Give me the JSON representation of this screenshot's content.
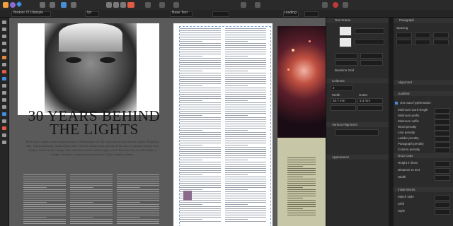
{
  "toolbar": {
    "personas": [
      "publisher-persona-icon",
      "photo-persona-icon",
      "designer-persona-icon"
    ],
    "font_size": "7pt"
  },
  "context": {
    "font_name": "Bodoni 72 Oldstyle",
    "font_size": "7pt",
    "leading_label": "Leading",
    "style_label": "Base Text"
  },
  "document": {
    "headline_line1": "30 YEARS BEHIND",
    "headline_line2": "THE LIGHTS",
    "intro": "Proin quis a turpis ut nisl euismod mauris. Pellentesque vel dui tortor non in ultricies sem mollis. Phasellus odio. Nulla adipiscing. Suspendisse dolor velit elit ullamcorper gravida. Proin quis a. Quisque semper est a tempor, mauris et nisl integer nisl, sed ultrices tortor nulla magna, vitae. Praesent nisi, ut sollicitudin ut tempus. Sed quis, maximus non viverra sit. Donec dapibus, lorem."
  },
  "text_panel": {
    "title": "Text Frame",
    "columns_label": "Columns",
    "columns_value": "2",
    "width_label": "Width",
    "gutter_label": "Gutter",
    "width_value": "46.7 mm",
    "gutter_value": "5.4 mm",
    "baseline_label": "Baseline Grid",
    "section_columns": "Columns",
    "section_text_wrap": "Text Wrap",
    "section_vertical": "Vertical Alignment",
    "section_appearance": "Appearance"
  },
  "paragraph_panel": {
    "title": "Paragraph",
    "spacing_label": "Spacing",
    "alignment_label": "Alignment",
    "justified_label": "Justified",
    "hyphenation_label": "Use auto hyphenation",
    "hyphenation_rows": [
      "Minimum word length",
      "Minimum prefix",
      "Minimum suffix",
      "Word penalty",
      "Line penalty",
      "Ladder penalty",
      "Paragraph penalty",
      "Column penalty"
    ],
    "drop_caps_label": "Drop Caps",
    "drop_caps_rows": [
      "Height in lines",
      "Distance to text",
      "Width"
    ],
    "initial_words_label": "Initial Words",
    "initial_words_rows": [
      "Match style",
      "Shift",
      "Style"
    ]
  },
  "colors": {
    "accent": "#e25b45",
    "panel_bg": "#2b2b2b",
    "olive_panel": "#c7c6a7"
  }
}
